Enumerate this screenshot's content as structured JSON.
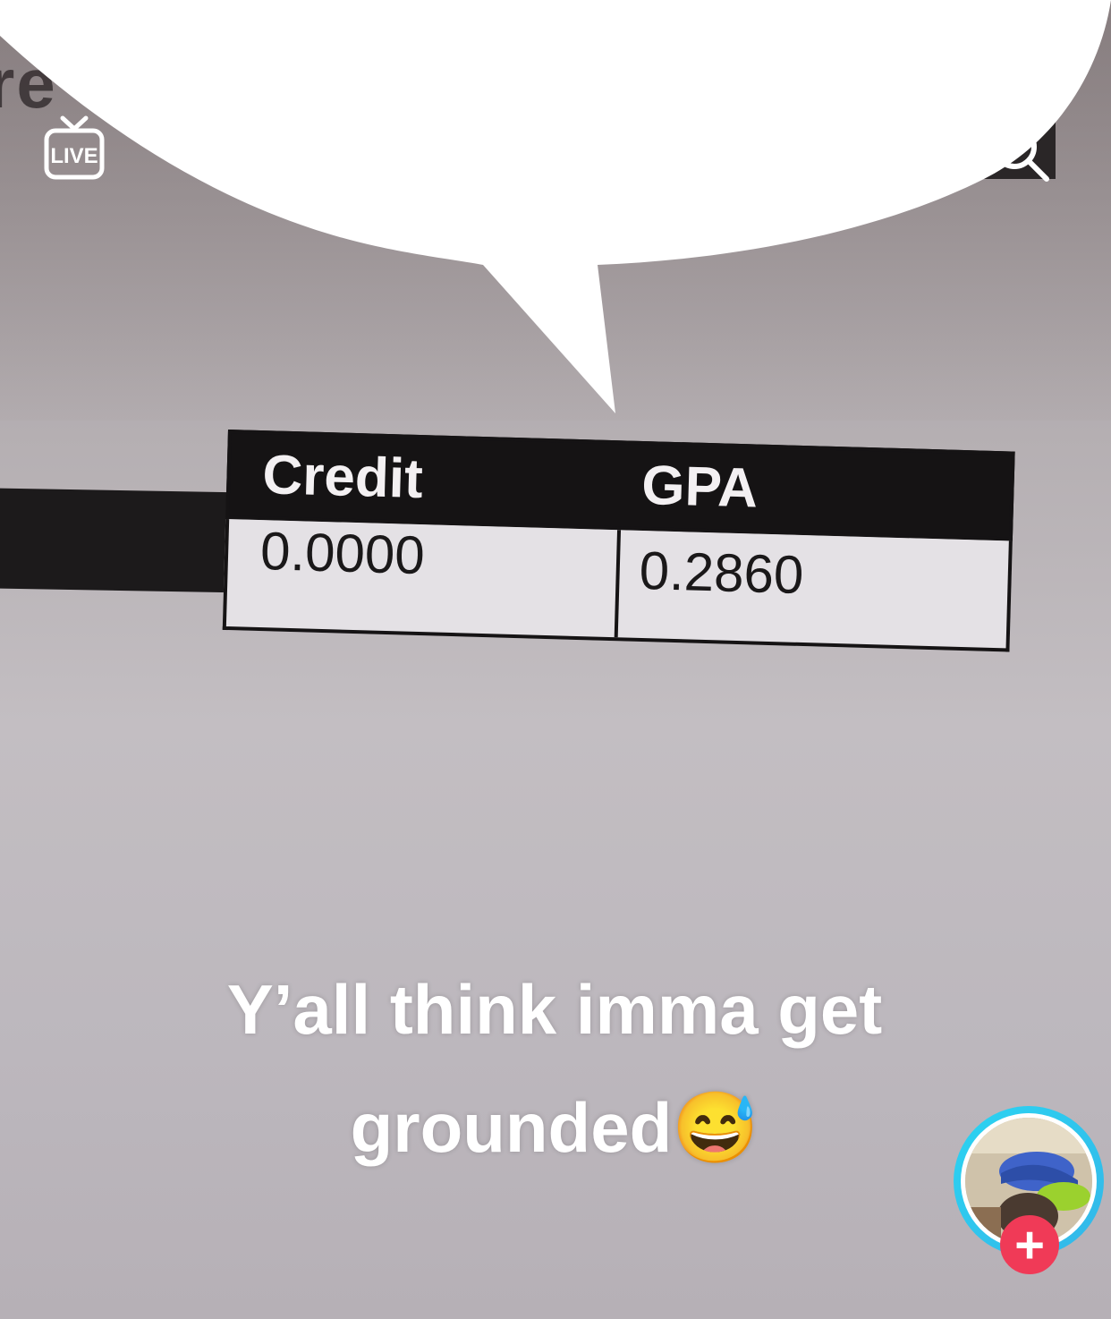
{
  "top_bar": {
    "live_label": "LIVE"
  },
  "video": {
    "background_partial_text": "re",
    "table": {
      "headers": [
        "Credit",
        "GPA"
      ],
      "values": [
        "0.0000",
        "0.2860"
      ]
    },
    "caption": "Y’all think imma get grounded😅"
  },
  "creator": {
    "follow_label": "+"
  },
  "icons": {
    "live": "live-tv-icon",
    "search": "search-icon",
    "follow": "plus-icon"
  },
  "colors": {
    "follow_accent": "#f03a57",
    "avatar_ring": "#2bd4f2",
    "caption_text": "#ffffff"
  }
}
